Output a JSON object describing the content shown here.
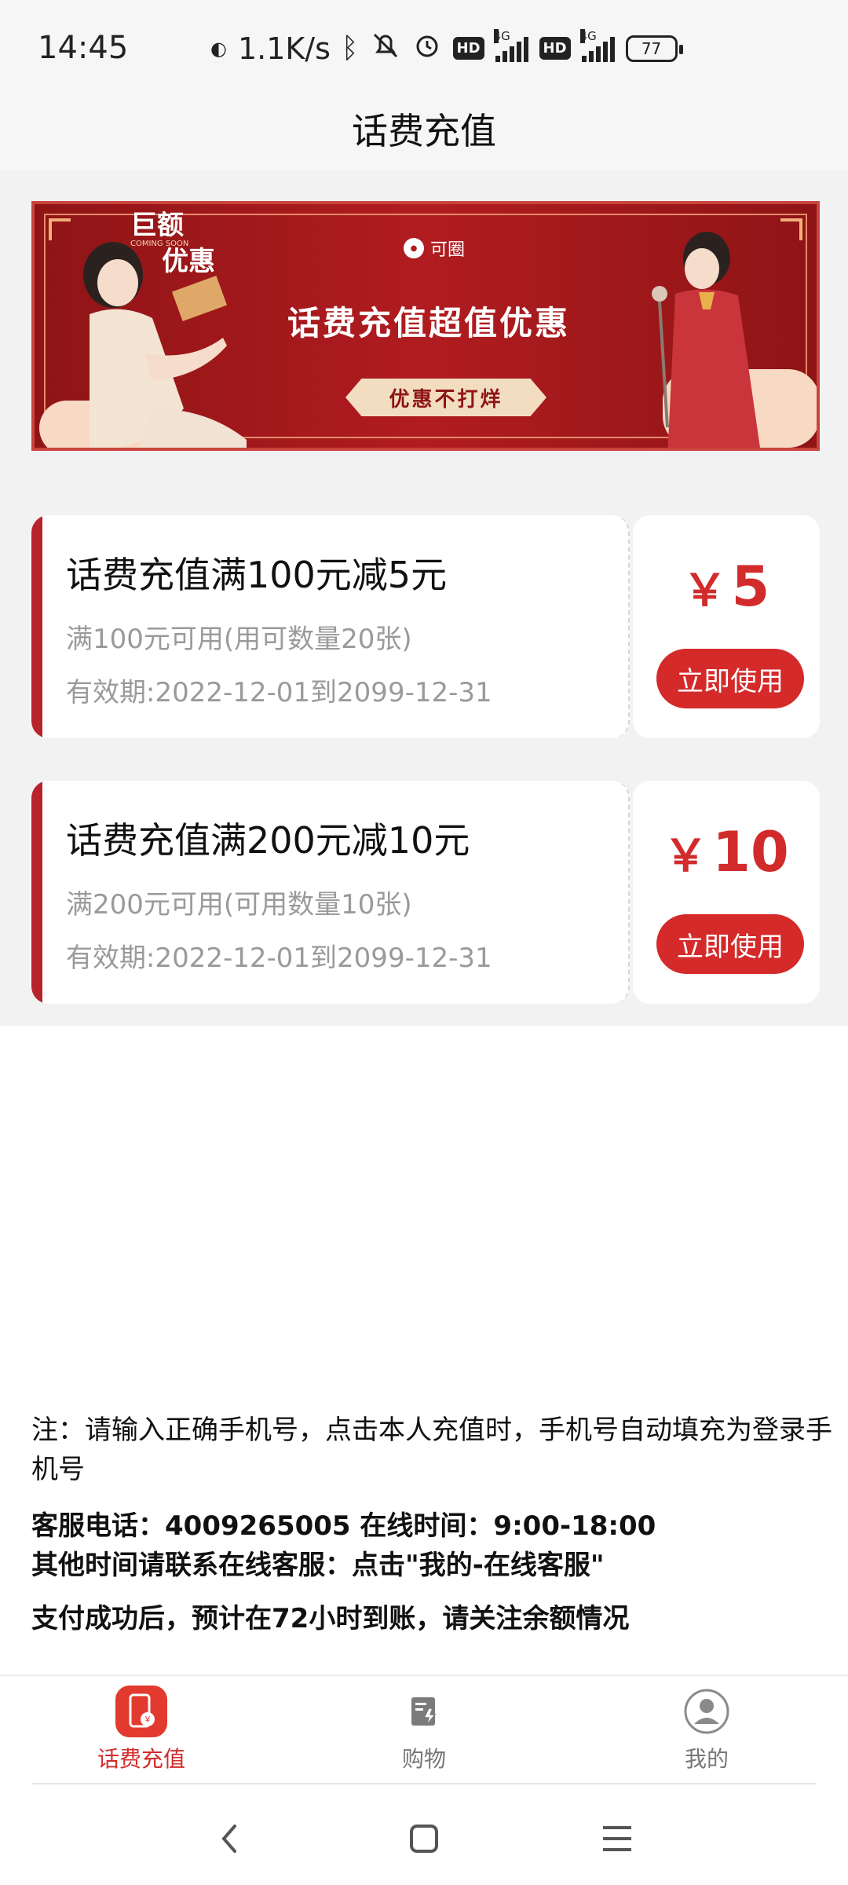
{
  "status_bar": {
    "time": "14:45",
    "network_speed": "1.1K/s",
    "signal_label_1": "4G",
    "signal_label_2": "4G",
    "hd_label": "HD",
    "battery": "77"
  },
  "header": {
    "title": "话费充值"
  },
  "banner": {
    "title": "话费充值超值优惠",
    "pill_text": "优惠不打烊",
    "badge_line1": "巨额",
    "badge_line2": "优惠",
    "badge_small": "COMING SOON",
    "brand_text": "可圈"
  },
  "coupons": [
    {
      "title": "话费充值满100元减5元",
      "condition": "满100元可用(用可数量20张)",
      "validity": "有效期:2022-12-01到2099-12-31",
      "currency": "￥",
      "amount": "5",
      "button": "立即使用"
    },
    {
      "title": "话费充值满200元减10元",
      "condition": "满200元可用(可用数量10张)",
      "validity": "有效期:2022-12-01到2099-12-31",
      "currency": "￥",
      "amount": "10",
      "button": "立即使用"
    }
  ],
  "notes": {
    "line1": "注：请输入正确手机号，点击本人充值时，手机号自动填充为登录手机号",
    "line2": "客服电话：4009265005 在线时间：9:00-18:00",
    "line3": "其他时间请联系在线客服：点击\"我的-在线客服\"",
    "line4": "支付成功后，预计在72小时到账，请关注余额情况"
  },
  "tabbar": {
    "items": [
      {
        "label": "话费充值",
        "icon": "phone-recharge-icon",
        "active": true
      },
      {
        "label": "购物",
        "icon": "shopping-bag-icon",
        "active": false
      },
      {
        "label": "我的",
        "icon": "user-avatar-icon",
        "active": false
      }
    ]
  },
  "colors": {
    "accent": "#d42a2a",
    "banner_red": "#b01c20",
    "muted_text": "#9a9a9a"
  }
}
